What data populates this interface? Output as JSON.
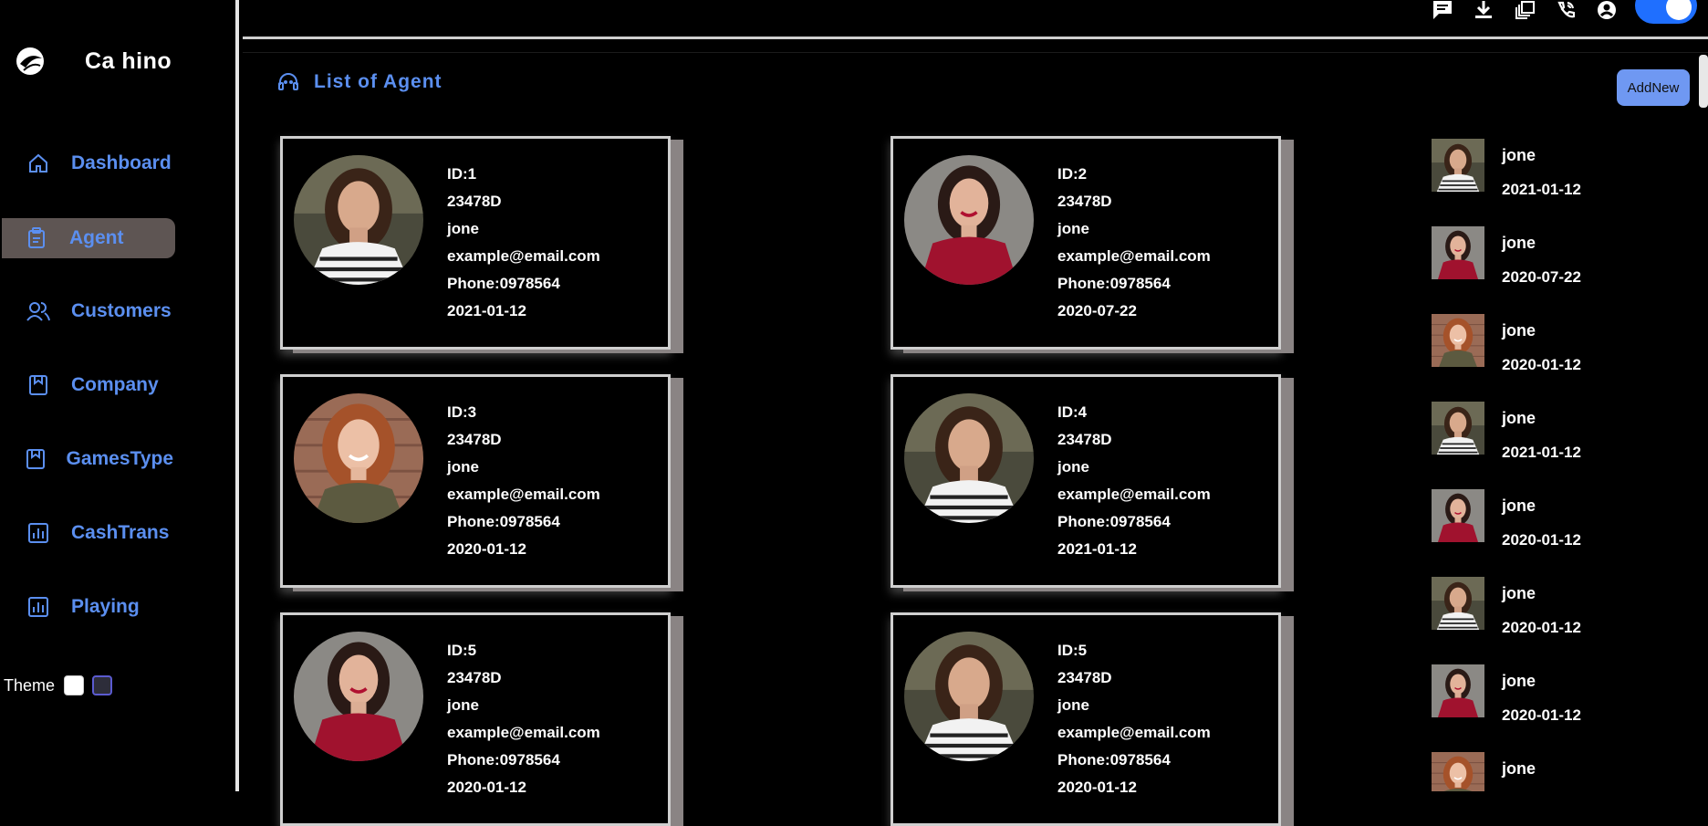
{
  "app": {
    "name": "Ca  hino"
  },
  "sidebar": {
    "items": [
      {
        "label": "Dashboard",
        "icon": "home-icon"
      },
      {
        "label": "Agent",
        "icon": "clipboard-icon",
        "active": true
      },
      {
        "label": "Customers",
        "icon": "users-icon"
      },
      {
        "label": "Company",
        "icon": "bookmark-icon"
      },
      {
        "label": "GamesType",
        "icon": "bookmark-icon"
      },
      {
        "label": "CashTrans",
        "icon": "bar-chart-icon"
      },
      {
        "label": "Playing",
        "icon": "bar-chart-icon"
      }
    ],
    "theme_label": "Theme"
  },
  "topbar": {
    "icons": [
      "message-icon",
      "download-icon",
      "copy-icon",
      "phone-icon",
      "user-circle-icon",
      "gear-icon"
    ],
    "toggle_on": true
  },
  "main": {
    "title": "List of Agent",
    "add_button": "AddNew",
    "agents": [
      {
        "id": "ID:1",
        "code": "23478D",
        "name": "jone",
        "email": "example@email.com",
        "phone": "Phone:0978564",
        "date": "2021-01-12",
        "portrait": "striped"
      },
      {
        "id": "ID:2",
        "code": "23478D",
        "name": "jone",
        "email": "example@email.com",
        "phone": "Phone:0978564",
        "date": "2020-07-22",
        "portrait": "red"
      },
      {
        "id": "ID:3",
        "code": "23478D",
        "name": "jone",
        "email": "example@email.com",
        "phone": "Phone:0978564",
        "date": "2020-01-12",
        "portrait": "redhead"
      },
      {
        "id": "ID:4",
        "code": "23478D",
        "name": "jone",
        "email": "example@email.com",
        "phone": "Phone:0978564",
        "date": "2021-01-12",
        "portrait": "striped"
      },
      {
        "id": "ID:5",
        "code": "23478D",
        "name": "jone",
        "email": "example@email.com",
        "phone": "Phone:0978564",
        "date": "2020-01-12",
        "portrait": "red"
      },
      {
        "id": "ID:5",
        "code": "23478D",
        "name": "jone",
        "email": "example@email.com",
        "phone": "Phone:0978564",
        "date": "2020-01-12",
        "portrait": "striped"
      }
    ],
    "recent": [
      {
        "name": "jone",
        "date": "2021-01-12",
        "portrait": "striped"
      },
      {
        "name": "jone",
        "date": "2020-07-22",
        "portrait": "red"
      },
      {
        "name": "jone",
        "date": "2020-01-12",
        "portrait": "redhead"
      },
      {
        "name": "jone",
        "date": "2021-01-12",
        "portrait": "striped"
      },
      {
        "name": "jone",
        "date": "2020-01-12",
        "portrait": "red"
      },
      {
        "name": "jone",
        "date": "2020-01-12",
        "portrait": "striped"
      },
      {
        "name": "jone",
        "date": "2020-01-12",
        "portrait": "red"
      },
      {
        "name": "jone",
        "date": "",
        "portrait": "redhead"
      }
    ]
  },
  "colors": {
    "accent": "#5b8ff0",
    "active_bg": "#5e5553",
    "button": "#6f98f2",
    "toggle": "#1f6fff"
  }
}
